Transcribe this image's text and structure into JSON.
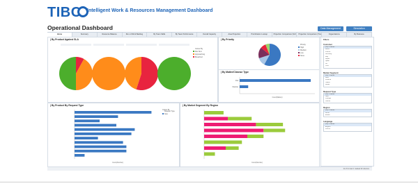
{
  "header": {
    "brand": "TIBC",
    "subtitle": "Intelligent Work & Resources Management Dashboard",
    "page_title": "Operational Dashboard",
    "buttons": [
      "Data Management",
      "Simulation"
    ]
  },
  "tabs": [
    "Home",
    "Summary",
    "Resource Balance",
    "Run of Work Backlog",
    "By Team Skills",
    "By Team Performance",
    "Overall Capacity",
    "Area Projection",
    "Prioritization Lookup",
    "Projection Comparison (Schedule)",
    "Projection Comparison (Timeline)",
    "Organizations",
    "By Business"
  ],
  "panels": {
    "sla": {
      "title": "| By Product Against SLA",
      "pies": [
        {
          "label": "",
          "slices": [
            0.08,
            0.42,
            0.5
          ],
          "colors": [
            "#e8243f",
            "#ff8c1a",
            "#4cae2c"
          ]
        },
        {
          "label": "",
          "slices": [
            1.0
          ],
          "colors": [
            "#ff8c1a"
          ]
        },
        {
          "label": "",
          "slices": [
            0.55,
            0.45
          ],
          "colors": [
            "#e8243f",
            "#ff8c1a"
          ]
        },
        {
          "label": "",
          "slices": [
            1.0
          ],
          "colors": [
            "#4cae2c"
          ]
        }
      ],
      "legend": [
        "Colour By",
        "Met SLA",
        "Approaching",
        "Breached"
      ]
    },
    "priority": {
      "title": "| By Priority",
      "slices": [
        0.58,
        0.12,
        0.16,
        0.08,
        0.06
      ],
      "colors": [
        "#3a78c2",
        "#a8c6e6",
        "#7a2e5b",
        "#e8243f",
        "#9bd36d"
      ],
      "legend": [
        "Priority",
        "High",
        "Medium",
        "Low",
        "None"
      ]
    },
    "matter": {
      "title": "| By Matter/Cleanse Type",
      "categories": [
        "Pull",
        "Cleanse"
      ],
      "values": [
        1.0,
        0.12
      ],
      "axis_label": "Count(Mattter)"
    },
    "request": {
      "title": "| By Product By Request Type",
      "values": [
        0.92,
        0.52,
        0.3,
        0.5,
        0.72,
        0.68,
        0.28,
        0.58,
        0.62,
        0.62,
        0.12
      ],
      "legend_title": "Colour By",
      "legend": [
        "Request Type",
        "New"
      ],
      "axis_label": "Count(Number)"
    },
    "region": {
      "title": "| By Market Segment By Region",
      "rows": [
        {
          "green": 0.18,
          "pink": 0.0
        },
        {
          "green": 0.22,
          "pink": 0.22
        },
        {
          "green": 0.25,
          "pink": 0.48
        },
        {
          "green": 0.2,
          "pink": 0.55
        },
        {
          "green": 0.15,
          "pink": 0.4
        },
        {
          "green": 0.35,
          "pink": 0.0
        },
        {
          "green": 0.12,
          "pink": 0.2
        },
        {
          "green": 0.1,
          "pink": 0.0
        }
      ],
      "colors": [
        "#ee1c73",
        "#9bcb3c"
      ],
      "axis_label": "Count(Number)"
    }
  },
  "filters": {
    "title": "Filters",
    "sections": [
      {
        "name": "Customer",
        "items": [
          "(All) 8 values",
          "Brazil",
          "France",
          "Germany",
          "Italy",
          "Japan",
          "Spain",
          "UK",
          "USA"
        ]
      },
      {
        "name": "Market Segment",
        "items": [
          "(All) 5 values",
          "Auto",
          "Finance",
          "Health",
          "Retail"
        ]
      },
      {
        "name": "Request Type",
        "items": [
          "(All) 3 values",
          "New",
          "Change",
          "Cancel"
        ]
      },
      {
        "name": "Region",
        "items": [
          "(All) 4 values",
          "APAC",
          "EMEA"
        ]
      },
      {
        "name": "Language",
        "items": [
          "(All) 5 values",
          "English",
          "French"
        ]
      }
    ]
  },
  "status": "11 of 11 rows   1 marked   32 columns"
}
